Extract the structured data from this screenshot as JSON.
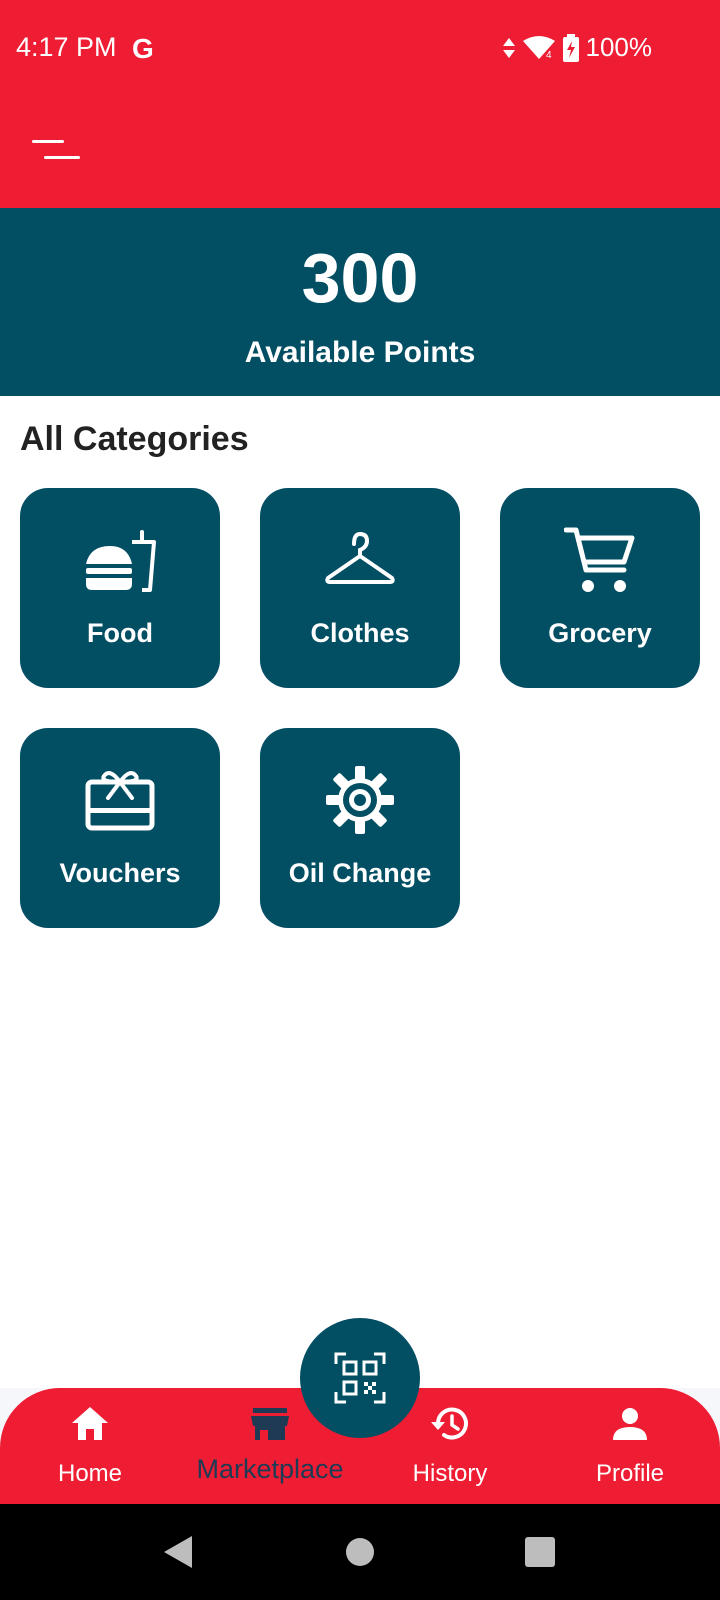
{
  "status_bar": {
    "time": "4:17 PM",
    "google_icon": "G",
    "battery": "100%"
  },
  "app_bar": {
    "menu_icon": "menu-icon"
  },
  "points": {
    "value": "300",
    "label": "Available Points"
  },
  "categories": {
    "title": "All Categories",
    "items": [
      {
        "label": "Food",
        "icon": "fastfood-icon"
      },
      {
        "label": "Clothes",
        "icon": "hanger-icon"
      },
      {
        "label": "Grocery",
        "icon": "cart-icon"
      },
      {
        "label": "Vouchers",
        "icon": "gift-card-icon"
      },
      {
        "label": "Oil Change",
        "icon": "gear-icon"
      }
    ]
  },
  "bottom_nav": {
    "items": [
      {
        "label": "Home",
        "icon": "home-icon"
      },
      {
        "label": "Marketplace",
        "icon": "store-icon",
        "active": true
      },
      {
        "label": "History",
        "icon": "history-icon"
      },
      {
        "label": "Profile",
        "icon": "person-icon"
      }
    ],
    "scan_icon": "qr-code-icon"
  },
  "colors": {
    "primary_red": "#ee1d33",
    "teal": "#024e63",
    "active_nav": "#1f3a55"
  }
}
